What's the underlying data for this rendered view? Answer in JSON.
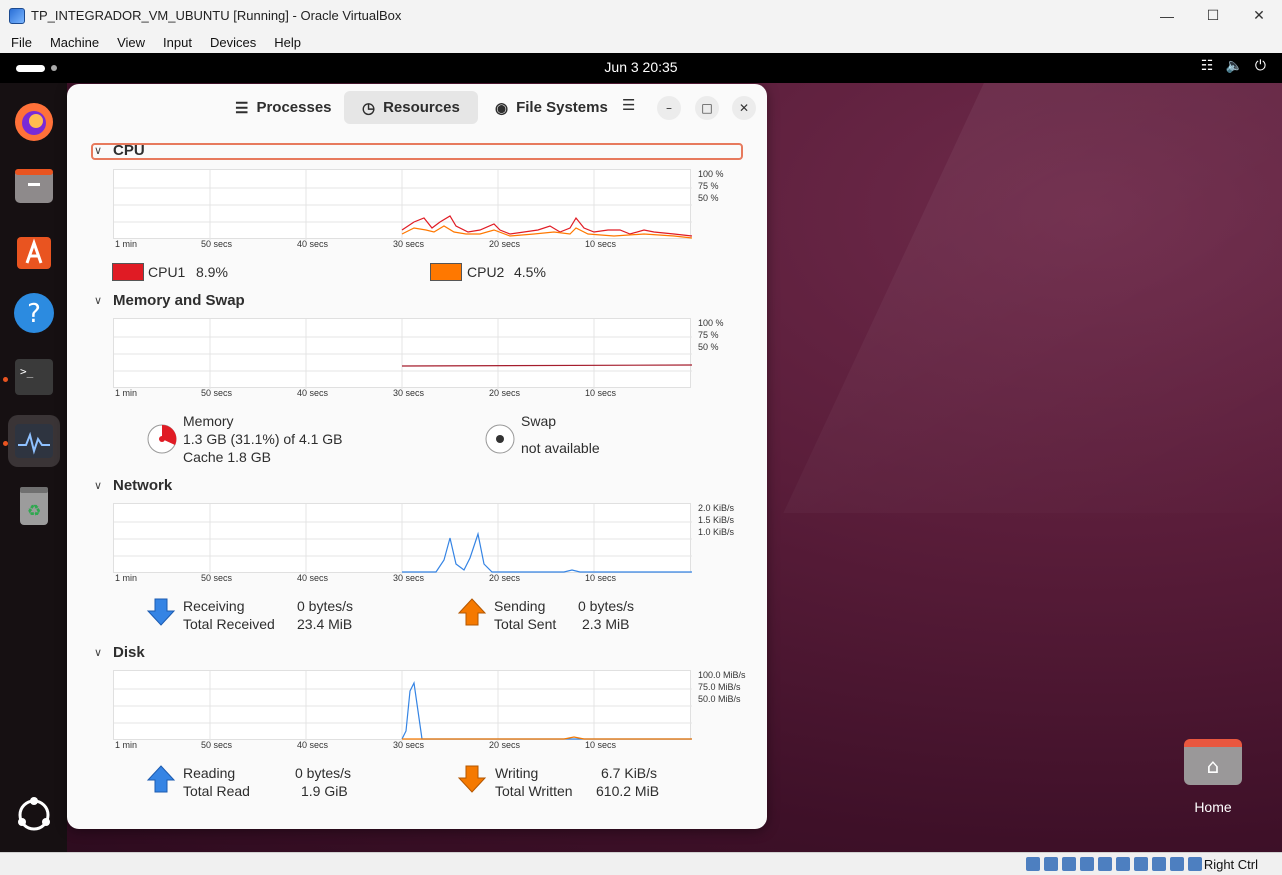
{
  "host": {
    "title": "TP_INTEGRADOR_VM_UBUNTU [Running] - Oracle VirtualBox",
    "menu": [
      "File",
      "Machine",
      "View",
      "Input",
      "Devices",
      "Help"
    ],
    "host_key": "Right Ctrl"
  },
  "guest": {
    "clock": "Jun 3  20:35",
    "home_label": "Home"
  },
  "app": {
    "tabs": [
      {
        "label": "Processes"
      },
      {
        "label": "Resources"
      },
      {
        "label": "File Systems"
      }
    ],
    "time_axis": [
      "1 min",
      "50 secs",
      "40 secs",
      "30 secs",
      "20 secs",
      "10 secs"
    ],
    "cpu": {
      "title": "CPU",
      "yaxis": [
        "100 %",
        "75 %",
        "50 %"
      ],
      "cpu1_label": "CPU1",
      "cpu1_value": "8.9%",
      "cpu1_color": "#e01b24",
      "cpu2_label": "CPU2",
      "cpu2_value": "4.5%",
      "cpu2_color": "#ff7800"
    },
    "memory": {
      "title": "Memory and Swap",
      "yaxis": [
        "100 %",
        "75 %",
        "50 %"
      ],
      "mem_label": "Memory",
      "mem_value": "1.3 GB (31.1%) of 4.1 GB",
      "cache": "Cache 1.8 GB",
      "swap_label": "Swap",
      "swap_value": "not available"
    },
    "network": {
      "title": "Network",
      "yaxis": [
        "2.0 KiB/s",
        "1.5 KiB/s",
        "1.0 KiB/s"
      ],
      "recv_label": "Receiving",
      "recv_value": "0 bytes/s",
      "total_recv_label": "Total Received",
      "total_recv_value": "23.4 MiB",
      "send_label": "Sending",
      "send_value": "0 bytes/s",
      "total_sent_label": "Total Sent",
      "total_sent_value": "2.3 MiB"
    },
    "disk": {
      "title": "Disk",
      "yaxis": [
        "100.0 MiB/s",
        "75.0 MiB/s",
        "50.0 MiB/s"
      ],
      "read_label": "Reading",
      "read_value": "0 bytes/s",
      "total_read_label": "Total Read",
      "total_read_value": "1.9 GiB",
      "write_label": "Writing",
      "write_value": "6.7 KiB/s",
      "total_written_label": "Total Written",
      "total_written_value": "610.2 MiB"
    }
  }
}
